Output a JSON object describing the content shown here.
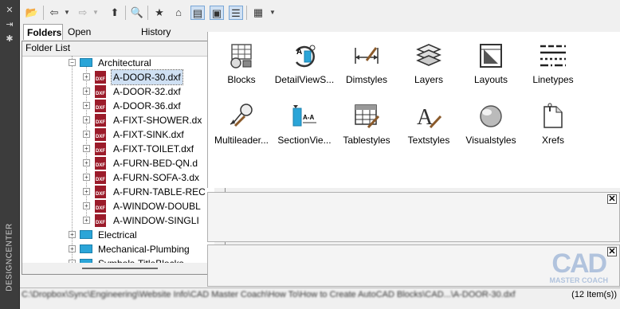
{
  "window": {
    "vertical_title": "DESIGNCENTER"
  },
  "tabs": [
    {
      "label": "Folders",
      "active": true
    },
    {
      "label": "Open Drawings",
      "active": false
    },
    {
      "label": "History",
      "active": false
    }
  ],
  "folder_list": {
    "title": "Folder List",
    "tree": [
      {
        "label": "Architectural",
        "type": "folder",
        "expanded": true
      },
      {
        "label": "A-DOOR-30.dxf",
        "type": "dxf",
        "selected": true
      },
      {
        "label": "A-DOOR-32.dxf",
        "type": "dxf"
      },
      {
        "label": "A-DOOR-36.dxf",
        "type": "dxf"
      },
      {
        "label": "A-FIXT-SHOWER.dx",
        "type": "dxf"
      },
      {
        "label": "A-FIXT-SINK.dxf",
        "type": "dxf"
      },
      {
        "label": "A-FIXT-TOILET.dxf",
        "type": "dxf"
      },
      {
        "label": "A-FURN-BED-QN.d",
        "type": "dxf"
      },
      {
        "label": "A-FURN-SOFA-3.dx",
        "type": "dxf"
      },
      {
        "label": "A-FURN-TABLE-REC",
        "type": "dxf"
      },
      {
        "label": "A-WINDOW-DOUBL",
        "type": "dxf"
      },
      {
        "label": "A-WINDOW-SINGLI",
        "type": "dxf"
      },
      {
        "label": "Electrical",
        "type": "folder",
        "expanded": false
      },
      {
        "label": "Mechanical-Plumbing",
        "type": "folder",
        "expanded": false
      },
      {
        "label": "Symbols-TitleBlocks",
        "type": "folder",
        "expanded": false
      }
    ]
  },
  "content_items": [
    {
      "label": "Blocks",
      "icon": "blocks-icon"
    },
    {
      "label": "DetailViewS...",
      "icon": "detail-view-styles-icon"
    },
    {
      "label": "Dimstyles",
      "icon": "dimstyles-icon"
    },
    {
      "label": "Layers",
      "icon": "layers-icon"
    },
    {
      "label": "Layouts",
      "icon": "layouts-icon"
    },
    {
      "label": "Linetypes",
      "icon": "linetypes-icon"
    },
    {
      "label": "Multileader...",
      "icon": "multileader-styles-icon"
    },
    {
      "label": "SectionVie...",
      "icon": "section-view-styles-icon"
    },
    {
      "label": "Tablestyles",
      "icon": "tablestyles-icon"
    },
    {
      "label": "Textstyles",
      "icon": "textstyles-icon"
    },
    {
      "label": "Visualstyles",
      "icon": "visualstyles-icon"
    },
    {
      "label": "Xrefs",
      "icon": "xrefs-icon"
    }
  ],
  "status": {
    "path": "C:\\Dropbox\\Sync\\Engineering\\Website Info\\CAD Master Coach\\How To\\How to Create AutoCAD Blocks\\CAD...\\A-DOOR-30.dxf",
    "count": "(12 Item(s))"
  },
  "watermark": {
    "big": "CAD",
    "small": "MASTER COACH"
  },
  "colors": {
    "accent": "#2aa5d8",
    "dxf": "#9b1b2a",
    "selection": "#cfe0f3"
  }
}
